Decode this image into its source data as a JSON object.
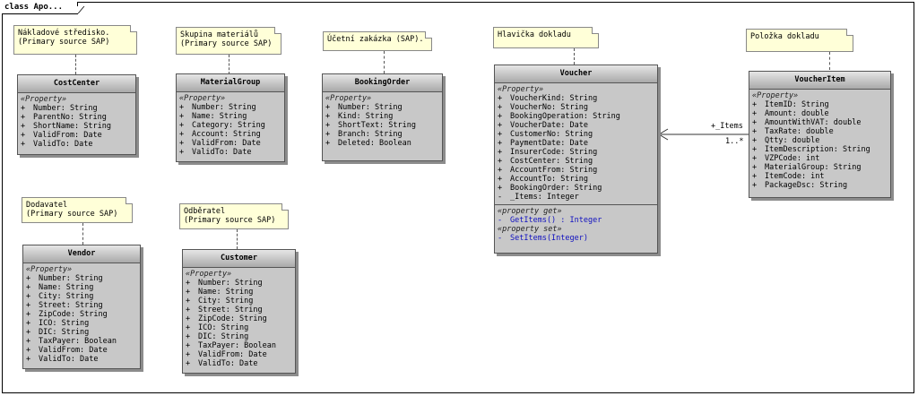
{
  "frame": {
    "label": "class Apo..."
  },
  "notes": {
    "costcenter": "Nákladové středisko.\n(Primary source SAP)",
    "materialgroup": "Skupina materiálů\n(Primary source SAP)",
    "bookingorder": "Účetní zakázka (SAP).",
    "voucher": "Hlavička dokladu",
    "voucheritem": "Položka dokladu",
    "vendor": "Dodavatel\n(Primary source SAP)",
    "customer": "Odběratel\n(Primary source SAP)"
  },
  "classes": {
    "costcenter": {
      "name": "CostCenter",
      "stereotype": "«Property»",
      "attributes": [
        {
          "vis": "+",
          "text": "Number: String"
        },
        {
          "vis": "+",
          "text": "ParentNo: String"
        },
        {
          "vis": "+",
          "text": "ShortName: String"
        },
        {
          "vis": "+",
          "text": "ValidFrom: Date"
        },
        {
          "vis": "+",
          "text": "ValidTo: Date"
        }
      ]
    },
    "materialgroup": {
      "name": "MaterialGroup",
      "stereotype": "«Property»",
      "attributes": [
        {
          "vis": "+",
          "text": "Number: String"
        },
        {
          "vis": "+",
          "text": "Name: String"
        },
        {
          "vis": "+",
          "text": "Category: String"
        },
        {
          "vis": "+",
          "text": "Account: String"
        },
        {
          "vis": "+",
          "text": "ValidFrom: Date"
        },
        {
          "vis": "+",
          "text": "ValidTo: Date"
        }
      ]
    },
    "bookingorder": {
      "name": "BookingOrder",
      "stereotype": "«Property»",
      "attributes": [
        {
          "vis": "+",
          "text": "Number: String"
        },
        {
          "vis": "+",
          "text": "Kind: String"
        },
        {
          "vis": "+",
          "text": "ShortText: String"
        },
        {
          "vis": "+",
          "text": "Branch: String"
        },
        {
          "vis": "+",
          "text": "Deleted: Boolean"
        }
      ]
    },
    "voucher": {
      "name": "Voucher",
      "stereotype": "«Property»",
      "attributes": [
        {
          "vis": "+",
          "text": "VoucherKind: String"
        },
        {
          "vis": "+",
          "text": "VoucherNo: String"
        },
        {
          "vis": "+",
          "text": "BookingOperation: String"
        },
        {
          "vis": "+",
          "text": "VoucherDate: Date"
        },
        {
          "vis": "+",
          "text": "CustomerNo: String"
        },
        {
          "vis": "+",
          "text": "PaymentDate: Date"
        },
        {
          "vis": "+",
          "text": "InsurerCode: String"
        },
        {
          "vis": "+",
          "text": "CostCenter: String"
        },
        {
          "vis": "+",
          "text": "AccountFrom: String"
        },
        {
          "vis": "+",
          "text": "AccountTo: String"
        },
        {
          "vis": "+",
          "text": "BookingOrder: String"
        },
        {
          "vis": "-",
          "text": "_Items: Integer"
        }
      ],
      "get_stereotype": "«property get»",
      "get_op": {
        "vis": "-",
        "text": "GetItems() : Integer"
      },
      "set_stereotype": "«property set»",
      "set_op": {
        "vis": "-",
        "text": "SetItems(Integer)"
      }
    },
    "voucheritem": {
      "name": "VoucherItem",
      "stereotype": "«Property»",
      "attributes": [
        {
          "vis": "+",
          "text": "ItemID: String"
        },
        {
          "vis": "+",
          "text": "Amount: double"
        },
        {
          "vis": "+",
          "text": "AmountWithVAT: double"
        },
        {
          "vis": "+",
          "text": "TaxRate: double"
        },
        {
          "vis": "+",
          "text": "Qtty: double"
        },
        {
          "vis": "+",
          "text": "ItemDescription: String"
        },
        {
          "vis": "+",
          "text": "VZPCode: int"
        },
        {
          "vis": "+",
          "text": "MaterialGroup: String"
        },
        {
          "vis": "+",
          "text": "ItemCode: int"
        },
        {
          "vis": "+",
          "text": "PackageDsc: String"
        }
      ]
    },
    "vendor": {
      "name": "Vendor",
      "stereotype": "«Property»",
      "attributes": [
        {
          "vis": "+",
          "text": "Number: String"
        },
        {
          "vis": "+",
          "text": "Name: String"
        },
        {
          "vis": "+",
          "text": "City: String"
        },
        {
          "vis": "+",
          "text": "Street: String"
        },
        {
          "vis": "+",
          "text": "ZipCode: String"
        },
        {
          "vis": "+",
          "text": "ICO: String"
        },
        {
          "vis": "+",
          "text": "DIC: String"
        },
        {
          "vis": "+",
          "text": "TaxPayer: Boolean"
        },
        {
          "vis": "+",
          "text": "ValidFrom: Date"
        },
        {
          "vis": "+",
          "text": "ValidTo: Date"
        }
      ]
    },
    "customer": {
      "name": "Customer",
      "stereotype": "«Property»",
      "attributes": [
        {
          "vis": "+",
          "text": "Number: String"
        },
        {
          "vis": "+",
          "text": "Name: String"
        },
        {
          "vis": "+",
          "text": "City: String"
        },
        {
          "vis": "+",
          "text": "Street: String"
        },
        {
          "vis": "+",
          "text": "ZipCode: String"
        },
        {
          "vis": "+",
          "text": "ICO: String"
        },
        {
          "vis": "+",
          "text": "DIC: String"
        },
        {
          "vis": "+",
          "text": "TaxPayer: Boolean"
        },
        {
          "vis": "+",
          "text": "ValidFrom: Date"
        },
        {
          "vis": "+",
          "text": "ValidTo: Date"
        }
      ]
    }
  },
  "association": {
    "role": "+_Items",
    "multiplicity": "1..*"
  },
  "colors": {
    "note_bg": "#ffffd8",
    "class_bg": "#c8c8c8",
    "operation": "#1010c0"
  }
}
